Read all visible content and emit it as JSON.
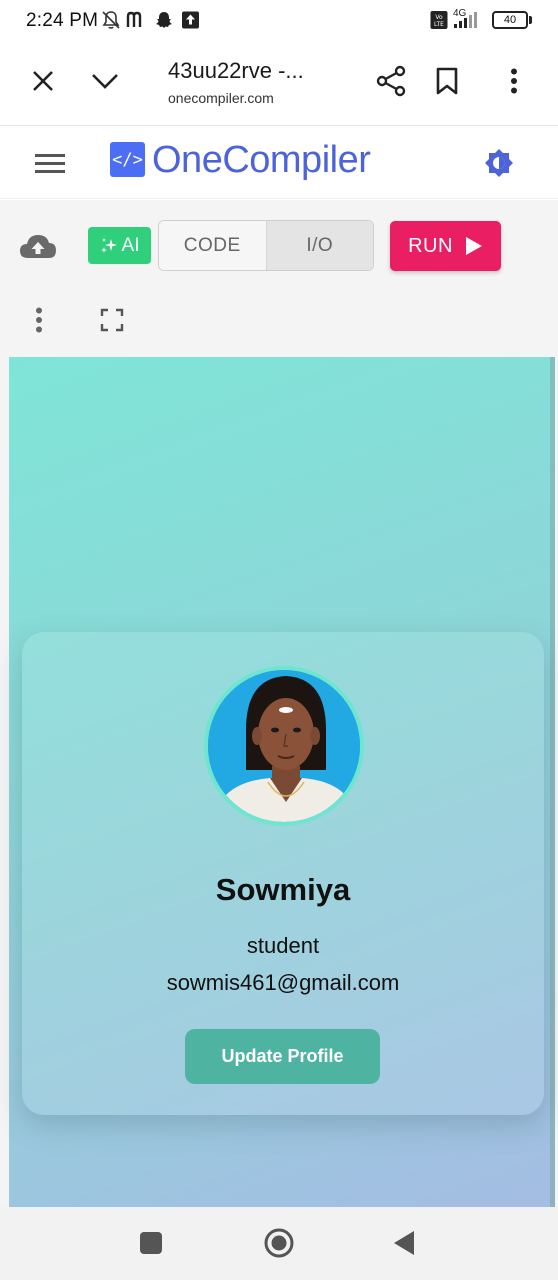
{
  "status_bar": {
    "time": "2:24 PM",
    "network": "4G",
    "volte": "Vo LTE",
    "battery": "40"
  },
  "browser": {
    "tab_title": "43uu22rve -...",
    "url": "onecompiler.com"
  },
  "site": {
    "logo_glyph": "</>",
    "logo_text": "OneCompiler"
  },
  "toolbar": {
    "ai_label": "AI",
    "tab_code": "CODE",
    "tab_io": "I/O",
    "run_label": "RUN"
  },
  "profile": {
    "name": "Sowmiya",
    "role": "student",
    "email": "sowmis461@gmail.com",
    "button_label": "Update Profile"
  },
  "colors": {
    "brand": "#4c63d9",
    "ai": "#2fcf7b",
    "run": "#ea1e63",
    "update_button": "#4fb3a1",
    "avatar_ring": "#6ee6cf"
  }
}
